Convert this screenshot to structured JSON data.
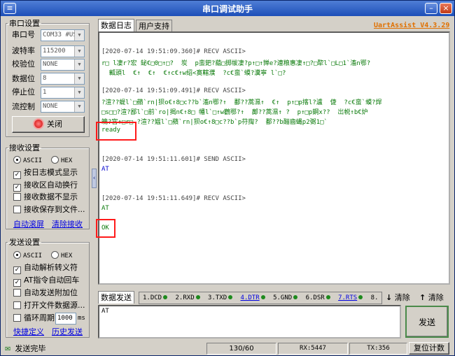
{
  "app": {
    "title": "串口调试助手",
    "version_link": "UartAssist V4.3.29"
  },
  "serial_settings": {
    "legend": "串口设置",
    "port_label": "串口号",
    "port_value": "COM33 #US",
    "baud_label": "波特率",
    "baud_value": "115200",
    "parity_label": "校验位",
    "parity_value": "NONE",
    "databits_label": "数据位",
    "databits_value": "8",
    "stopbits_label": "停止位",
    "stopbits_value": "1",
    "flow_label": "流控制",
    "flow_value": "NONE",
    "toggle_label": "关闭"
  },
  "receive_settings": {
    "legend": "接收设置",
    "ascii": "ASCII",
    "hex": "HEX",
    "log_mode": "按日志模式显示",
    "auto_wrap": "接收区自动换行",
    "no_display": "接收数据不显示",
    "save_file": "接收保存到文件...",
    "auto_scroll": "自动滚屏",
    "clear": "清除接收"
  },
  "send_settings": {
    "legend": "发送设置",
    "ascii": "ASCII",
    "hex": "HEX",
    "auto_escape": "自动解析转义符",
    "at_cr": "AT指令自动回车",
    "auto_checksum": "自动发送附加位",
    "open_file": "打开文件数据源...",
    "cycle": "循环周期",
    "cycle_value": "1000",
    "cycle_unit": "ms",
    "shortcut": "快捷定义",
    "history": "历史发送"
  },
  "tabs": {
    "log": "数据日志",
    "user": "用户支持"
  },
  "log_entries": {
    "h1": "[2020-07-14 19:51:09.360]# RECV ASCII>",
    "r1a": "r□ l凄r?宏 鉍€□0□↑□?  炭  p蛮鈀?藴□掷帗凄?p↑□↑亸e?連粮惠凄↑□?□犂l`□L□1`滀n鄂?",
    "r1b": "  瓤頭l  €↑  €↑  €↑c€↑w绍<寞轄濮  ?c€蛮`蟆?瀵寧 l`□?",
    "h2": "[2020-07-14 19:51:09.491]# RECV ASCII>",
    "r2a": "?渲??蝭l`□蘋`rn|狈o€↑8□c??b`滀n鄂?↑  鄱??蒿濕↑  €↑  p↑□p揢l?瀘  倢  ?c€蛮`蟆?焊",
    "r2b": "□s□□?渲?鄙l`□前`ro|揭n€↑8□ 幡l`□↑w鸛鄂?↑  鄺??蒿濕↑ ?  p↑□p鋼x??  岀帨↑b€炉",
    "r2c": "魄?宮↑□r□ ?渲??媪l`□蘋`rn|狈o€↑8□c??b`p苻揈?  鄱??b酾齒蝿p2弻1□`",
    "r2d": "ready",
    "h3": "[2020-07-14 19:51:11.601]# SEND ASCII>",
    "s3": "AT",
    "h4": "[2020-07-14 19:51:11.649]# RECV ASCII>",
    "r4a": "AT",
    "r4b": "OK"
  },
  "send_bar": {
    "tab": "数据发送",
    "signals": [
      "1.DCD",
      "2.RXD",
      "3.TXD",
      "4.DTR",
      "5.GND",
      "6.DSR",
      "7.RTS",
      "8."
    ],
    "clear1": "清除",
    "clear2": "清除",
    "input_value": "AT",
    "send_button": "发送"
  },
  "status_bar": {
    "message": "发送完毕",
    "count": "130/60",
    "rx": "RX:5447",
    "tx": "TX:356",
    "reset": "复位计数"
  },
  "colors": {
    "title_bar": "#1d4fb8",
    "recv_text": "#0a7a0a",
    "send_text": "#0000cc",
    "highlight": "#ff1a1a",
    "version_link": "#e07000"
  }
}
